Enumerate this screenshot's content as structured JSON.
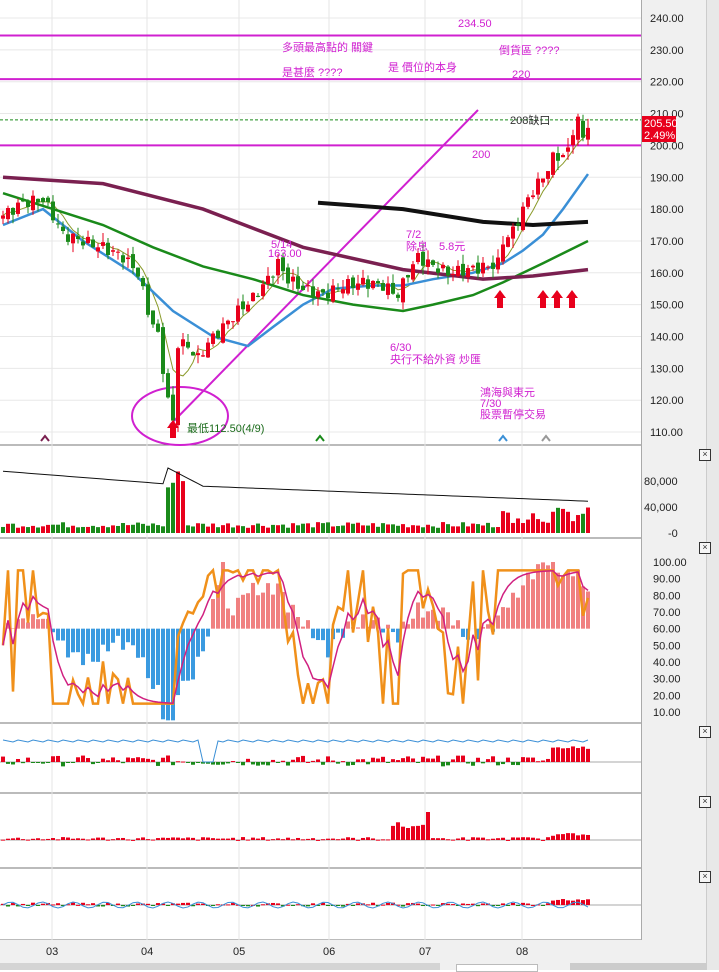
{
  "chart_data": {
    "type": "candlestick",
    "title": "",
    "price_axis": {
      "ticks": [
        "240.00",
        "230.00",
        "220.00",
        "210.00",
        "200.00",
        "190.00",
        "180.00",
        "170.00",
        "160.00",
        "150.00",
        "140.00",
        "130.00",
        "120.00",
        "110.00"
      ],
      "ylim": [
        108,
        243
      ]
    },
    "x_ticks": [
      "03",
      "04",
      "05",
      "06",
      "07",
      "08"
    ],
    "last_price": "205.50",
    "change_pct": "2.49%",
    "close_anchors": [
      [
        0,
        178
      ],
      [
        4,
        182
      ],
      [
        8,
        183
      ],
      [
        10,
        178
      ],
      [
        12,
        172
      ],
      [
        16,
        170
      ],
      [
        20,
        168
      ],
      [
        24,
        165
      ],
      [
        27,
        160
      ],
      [
        29,
        148
      ],
      [
        31,
        140
      ],
      [
        33,
        120
      ],
      [
        34,
        113
      ],
      [
        35,
        138
      ],
      [
        37,
        137
      ],
      [
        39,
        133
      ],
      [
        41,
        138
      ],
      [
        44,
        143
      ],
      [
        47,
        148
      ],
      [
        50,
        152
      ],
      [
        53,
        158
      ],
      [
        55,
        163
      ],
      [
        57,
        158
      ],
      [
        60,
        155
      ],
      [
        64,
        153
      ],
      [
        68,
        156
      ],
      [
        72,
        157
      ],
      [
        76,
        156
      ],
      [
        79,
        153
      ],
      [
        81,
        160
      ],
      [
        83,
        165
      ],
      [
        85,
        163
      ],
      [
        89,
        160
      ],
      [
        93,
        161
      ],
      [
        97,
        162
      ],
      [
        99,
        163
      ],
      [
        100,
        170
      ],
      [
        102,
        173
      ],
      [
        104,
        180
      ],
      [
        106,
        186
      ],
      [
        108,
        190
      ],
      [
        110,
        196
      ],
      [
        112,
        197
      ],
      [
        113,
        198
      ],
      [
        114,
        205
      ],
      [
        115,
        208
      ],
      [
        116,
        202
      ],
      [
        117,
        205.5
      ]
    ],
    "moving_averages": [
      {
        "name": "MA5",
        "color": "#8a9a2a",
        "type": "smooth-of-close"
      },
      {
        "name": "MA20",
        "color": "#3a8fd6",
        "points": [
          [
            0,
            175
          ],
          [
            8,
            180
          ],
          [
            16,
            170
          ],
          [
            26,
            160
          ],
          [
            34,
            148
          ],
          [
            42,
            140
          ],
          [
            49,
            137
          ],
          [
            54,
            143
          ],
          [
            60,
            150
          ],
          [
            66,
            155
          ],
          [
            74,
            156
          ],
          [
            80,
            156
          ],
          [
            86,
            158
          ],
          [
            94,
            160
          ],
          [
            100,
            163
          ],
          [
            104,
            167
          ],
          [
            108,
            172
          ],
          [
            112,
            180
          ],
          [
            117,
            191
          ]
        ]
      },
      {
        "name": "MA60",
        "color": "#1a8a1a",
        "points": [
          [
            0,
            185
          ],
          [
            10,
            180
          ],
          [
            20,
            175
          ],
          [
            30,
            168
          ],
          [
            40,
            162
          ],
          [
            50,
            158
          ],
          [
            60,
            153
          ],
          [
            70,
            150
          ],
          [
            80,
            148
          ],
          [
            86,
            150
          ],
          [
            94,
            153
          ],
          [
            100,
            157
          ],
          [
            108,
            163
          ],
          [
            117,
            170
          ]
        ]
      },
      {
        "name": "MA120",
        "color": "#7a2050",
        "points": [
          [
            0,
            190
          ],
          [
            20,
            188
          ],
          [
            40,
            180
          ],
          [
            60,
            168
          ],
          [
            80,
            161
          ],
          [
            96,
            158
          ],
          [
            106,
            159
          ],
          [
            117,
            161
          ]
        ]
      },
      {
        "name": "MA240",
        "color": "#111111",
        "points": [
          [
            63,
            182
          ],
          [
            80,
            180
          ],
          [
            96,
            176
          ],
          [
            106,
            175
          ],
          [
            117,
            176
          ]
        ]
      }
    ],
    "horizontal_lines": [
      {
        "price": 234.5,
        "label": "234.50"
      },
      {
        "price": 220.8,
        "label": "220"
      },
      {
        "price": 200,
        "label": "200"
      },
      {
        "price": 208,
        "label": "208缺口",
        "style": "dashed"
      }
    ],
    "annotations": {
      "a1": "多頭最高點的 關鍵",
      "a2": "是甚麼 ????",
      "a3": "是 價位的本身",
      "a4": "倒貨區 ????",
      "a5": "5/14",
      "a6": "163.00",
      "a7": "7/2",
      "a8": "除息　5.8元",
      "a9": "6/30",
      "a10": "央行不給外資  炒匯",
      "a11": "鴻海與東元",
      "a12": "7/30",
      "a13": "股票暫停交易",
      "low": "最低112.50(4/9)"
    },
    "volume_axis": {
      "ticks": [
        "80,000",
        "40,000",
        "-0"
      ],
      "ylim": [
        0,
        110000
      ]
    },
    "oscillator_axis": {
      "ticks": [
        "100.00",
        "90.00",
        "80.00",
        "70.00",
        "60.00",
        "50.00",
        "40.00",
        "30.00",
        "20.00",
        "10.00"
      ],
      "ylim": [
        0,
        105
      ]
    },
    "colors": {
      "up": "#e8001c",
      "down": "#1a8a1a",
      "annot": "#d020d0"
    }
  }
}
